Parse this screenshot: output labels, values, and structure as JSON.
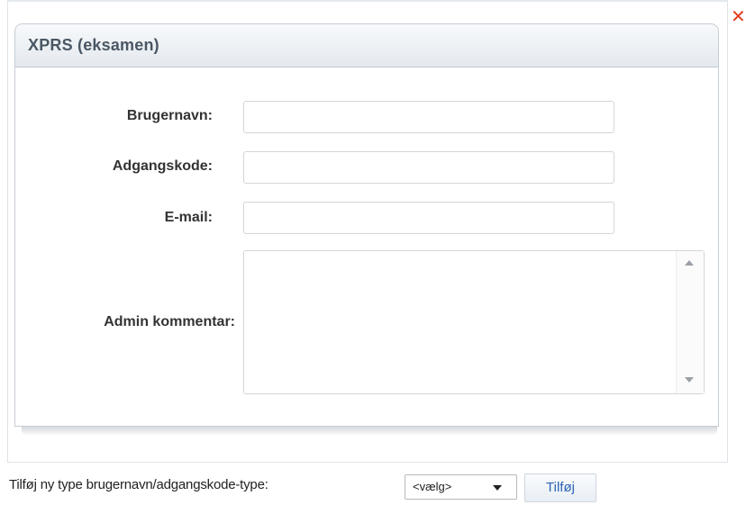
{
  "dialog": {
    "close_icon": "close-icon",
    "close_color": "#e03c1f",
    "title": "XPRS (eksamen)"
  },
  "form": {
    "username": {
      "label": "Brugernavn:",
      "value": ""
    },
    "password": {
      "label": "Adgangskode:",
      "value": ""
    },
    "email": {
      "label": "E-mail:",
      "value": ""
    },
    "comment": {
      "label": "Admin kommentar:",
      "value": ""
    }
  },
  "footer": {
    "add_type_label": "Tilføj ny type brugernavn/adgangskode-type:",
    "select_value": "<vælg>",
    "add_button_label": "Tilføj",
    "accent_color": "#2d64b3"
  }
}
